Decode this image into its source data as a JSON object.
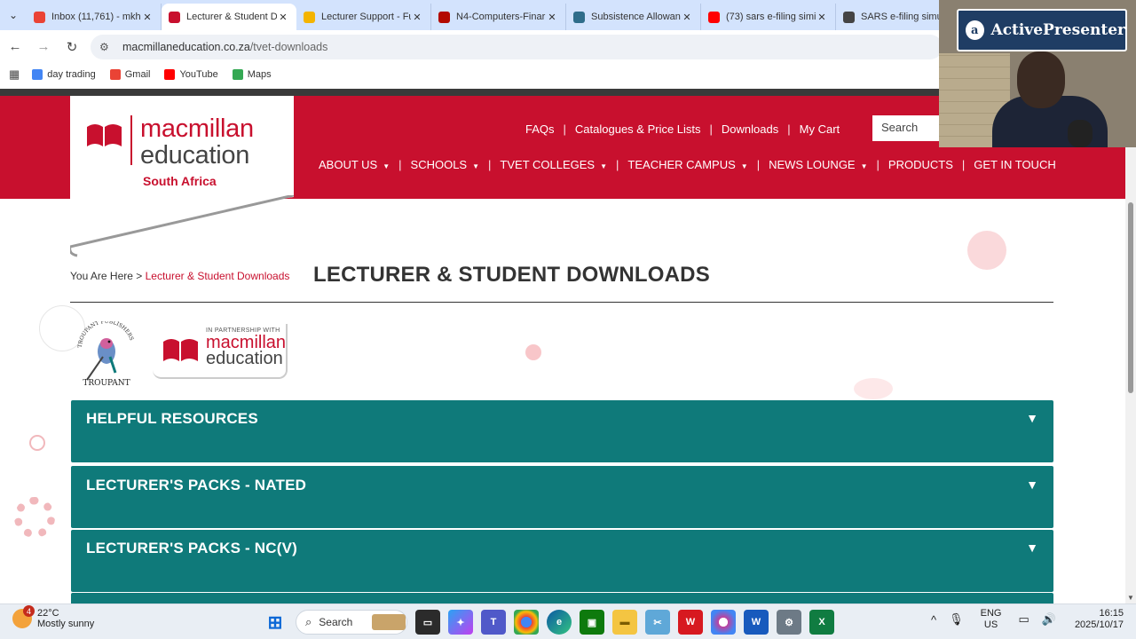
{
  "browser": {
    "tabs": [
      {
        "title": "Inbox (11,761) - mkh",
        "favicon_color": "#ea4335",
        "favicon_icon": "gmail-icon",
        "active": false
      },
      {
        "title": "Lecturer & Student D",
        "favicon_color": "#c8102e",
        "favicon_icon": "macmillan-icon",
        "active": true
      },
      {
        "title": "Lecturer Support - Fu",
        "favicon_color": "#f4b400",
        "favicon_icon": "lecturer-support-icon",
        "active": false
      },
      {
        "title": "N4-Computers-Finar",
        "favicon_color": "#b30b00",
        "favicon_icon": "pdf-icon",
        "active": false
      },
      {
        "title": "Subsistence Allowan",
        "favicon_color": "#2f6d8a",
        "favicon_icon": "sars-icon",
        "active": false
      },
      {
        "title": "(73) sars e-filing simi",
        "favicon_color": "#ff0000",
        "favicon_icon": "youtube-icon",
        "active": false
      },
      {
        "title": "SARS e-filing simula",
        "favicon_color": "#444444",
        "favicon_icon": "globe-icon",
        "active": false
      }
    ],
    "url_host": "macmillaneducation.co.za",
    "url_path": "/tvet-downloads",
    "bookmarks": [
      {
        "label": "day trading",
        "icon": "google-icon",
        "color": "#4285f4"
      },
      {
        "label": "Gmail",
        "icon": "gmail-icon",
        "color": "#ea4335"
      },
      {
        "label": "YouTube",
        "icon": "youtube-icon",
        "color": "#ff0000"
      },
      {
        "label": "Maps",
        "icon": "maps-icon",
        "color": "#34a853"
      }
    ]
  },
  "site": {
    "brand": {
      "line1": "macmillan",
      "line2": "education",
      "line3": "South Africa"
    },
    "top_nav": [
      "FAQs",
      "Catalogues & Price Lists",
      "Downloads",
      "My Cart"
    ],
    "search_placeholder": "Search",
    "main_nav": [
      {
        "label": "ABOUT US",
        "dropdown": true
      },
      {
        "label": "SCHOOLS",
        "dropdown": true
      },
      {
        "label": "TVET COLLEGES",
        "dropdown": true
      },
      {
        "label": "TEACHER CAMPUS",
        "dropdown": true
      },
      {
        "label": "NEWS LOUNGE",
        "dropdown": true
      },
      {
        "label": "PRODUCTS",
        "dropdown": false
      },
      {
        "label": "GET IN TOUCH",
        "dropdown": false
      }
    ],
    "breadcrumb": {
      "prefix": "You Are Here >",
      "current": "Lecturer & Student Downloads"
    },
    "page_title": "LECTURER & STUDENT DOWNLOADS",
    "partner": {
      "troupant_label": "TROUPANT",
      "troupant_ring": "TROUPANT PUBLISHERS",
      "small": "IN PARTNERSHIP WITH",
      "line1": "macmillan",
      "line2": "education"
    },
    "accordions": [
      "HELPFUL RESOURCES",
      "LECTURER'S PACKS - NATED",
      "LECTURER'S PACKS - NC(V)"
    ],
    "colors": {
      "brand_red": "#c8102e",
      "accordion_teal": "#0f7a7a"
    }
  },
  "overlay": {
    "label": "ActivePresenter"
  },
  "taskbar": {
    "weather_temp": "22°C",
    "weather_desc": "Mostly sunny",
    "weather_badge": "4",
    "search": "Search",
    "lang_line1": "ENG",
    "lang_line2": "US",
    "time": "16:15",
    "date": "2025/10/17"
  }
}
